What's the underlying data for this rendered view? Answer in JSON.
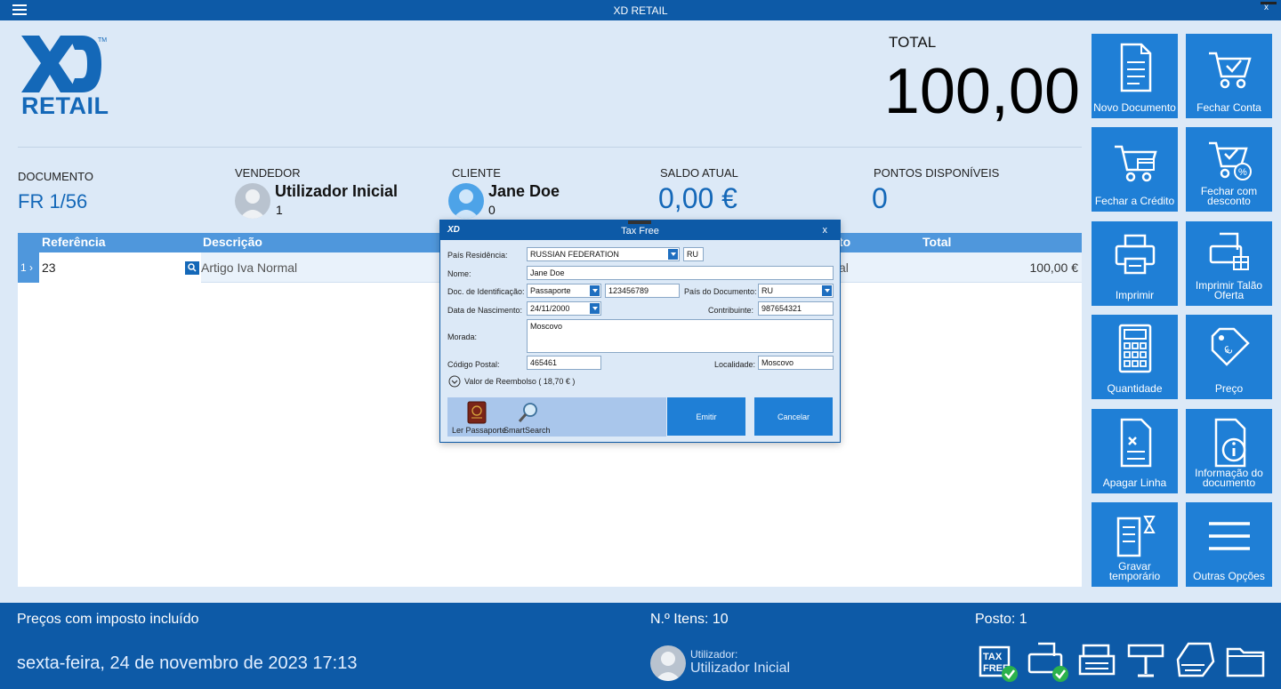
{
  "window": {
    "title": "XD RETAIL",
    "close_label": "x"
  },
  "logo": {
    "text": "RETAIL",
    "mark": "XD",
    "tm": "TM"
  },
  "total": {
    "label": "TOTAL",
    "value": "100,00"
  },
  "info": {
    "documento_label": "DOCUMENTO",
    "documento_value": "FR 1/56",
    "vendedor_label": "VENDEDOR",
    "vendedor_name": "Utilizador Inicial",
    "vendedor_sub": "1",
    "cliente_label": "CLIENTE",
    "cliente_name": "Jane Doe",
    "cliente_sub": "0",
    "saldo_label": "SALDO ATUAL",
    "saldo_value": "0,00 €",
    "pontos_label": "PONTOS DISPONÍVEIS",
    "pontos_value": "0"
  },
  "grid": {
    "headers": [
      "Referência",
      "Descrição",
      "to",
      "Total"
    ],
    "rows": [
      {
        "idx": "1",
        "ref": "23",
        "desc": "Artigo Iva Normal",
        "partial": "al",
        "total": "100,00 €"
      }
    ]
  },
  "tiles": [
    {
      "label": "Novo Documento",
      "icon": "document-icon"
    },
    {
      "label": "Fechar Conta",
      "icon": "cart-check-icon"
    },
    {
      "label": "Fechar a Crédito",
      "icon": "cart-card-icon"
    },
    {
      "label": "Fechar com desconto",
      "icon": "cart-discount-icon"
    },
    {
      "label": "Imprimir",
      "icon": "printer-icon"
    },
    {
      "label": "Imprimir Talão Oferta",
      "icon": "gift-receipt-icon"
    },
    {
      "label": "Quantidade",
      "icon": "calculator-icon"
    },
    {
      "label": "Preço",
      "icon": "price-tag-icon"
    },
    {
      "label": "Apagar Linha",
      "icon": "delete-line-icon"
    },
    {
      "label": "Informação do documento",
      "icon": "document-info-icon"
    },
    {
      "label": "Gravar temporário",
      "icon": "save-temp-icon"
    },
    {
      "label": "Outras Opções",
      "icon": "menu-icon"
    }
  ],
  "status": {
    "prices": "Preços com imposto incluído",
    "items": "N.º Itens: 10",
    "posto": "Posto: 1",
    "date": "sexta-feira, 24 de novembro de 2023 17:13",
    "user_label": "Utilizador:",
    "user": "Utilizador Inicial",
    "taxfree_icon_text": "TAX FREE"
  },
  "modal": {
    "title": "Tax Free",
    "close": "x",
    "logo": "XD",
    "pais_residencia_label": "País Residência:",
    "pais_residencia_value": "RUSSIAN FEDERATION",
    "pais_code": "RU",
    "nome_label": "Nome:",
    "nome_value": "Jane Doe",
    "doc_label": "Doc. de Identificação:",
    "doc_type": "Passaporte",
    "doc_number": "123456789",
    "pais_doc_label": "País do Documento:",
    "pais_doc_value": "RU",
    "nasc_label": "Data de Nascimento:",
    "nasc_value": "24/11/2000",
    "contrib_label": "Contribuinte:",
    "contrib_value": "987654321",
    "morada_label": "Morada:",
    "morada_value": "Moscovo",
    "cp_label": "Código Postal:",
    "cp_value": "465461",
    "localidade_label": "Localidade:",
    "localidade_value": "Moscovo",
    "reembolso": "Valor de Reembolso ( 18,70 € )",
    "ler_passaporte": "Ler Passaporte",
    "smartsearch": "SmartSearch",
    "emitir": "Emitir",
    "cancelar": "Cancelar"
  }
}
